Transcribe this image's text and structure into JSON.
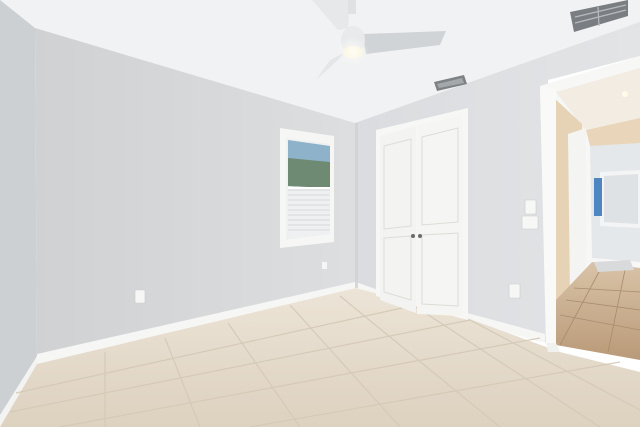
{
  "scene": {
    "description_visible_text": "",
    "colors": {
      "ceiling": "#f3f4f5",
      "left_wall": "#d8dadc",
      "back_wall": "#dfe1e3",
      "right_wall": "#e4e5e7",
      "baseboard": "#f7f7f6",
      "floor_light": "#e6dccd",
      "floor_dark": "#cfc3b1",
      "grout": "#d9cfbf",
      "door_white": "#f4f4f2",
      "hall_floor": "#c7ab8b",
      "hall_wall": "#eadcc6",
      "fan_blade": "#d3d5d8",
      "vent": "#8a8d91"
    }
  }
}
